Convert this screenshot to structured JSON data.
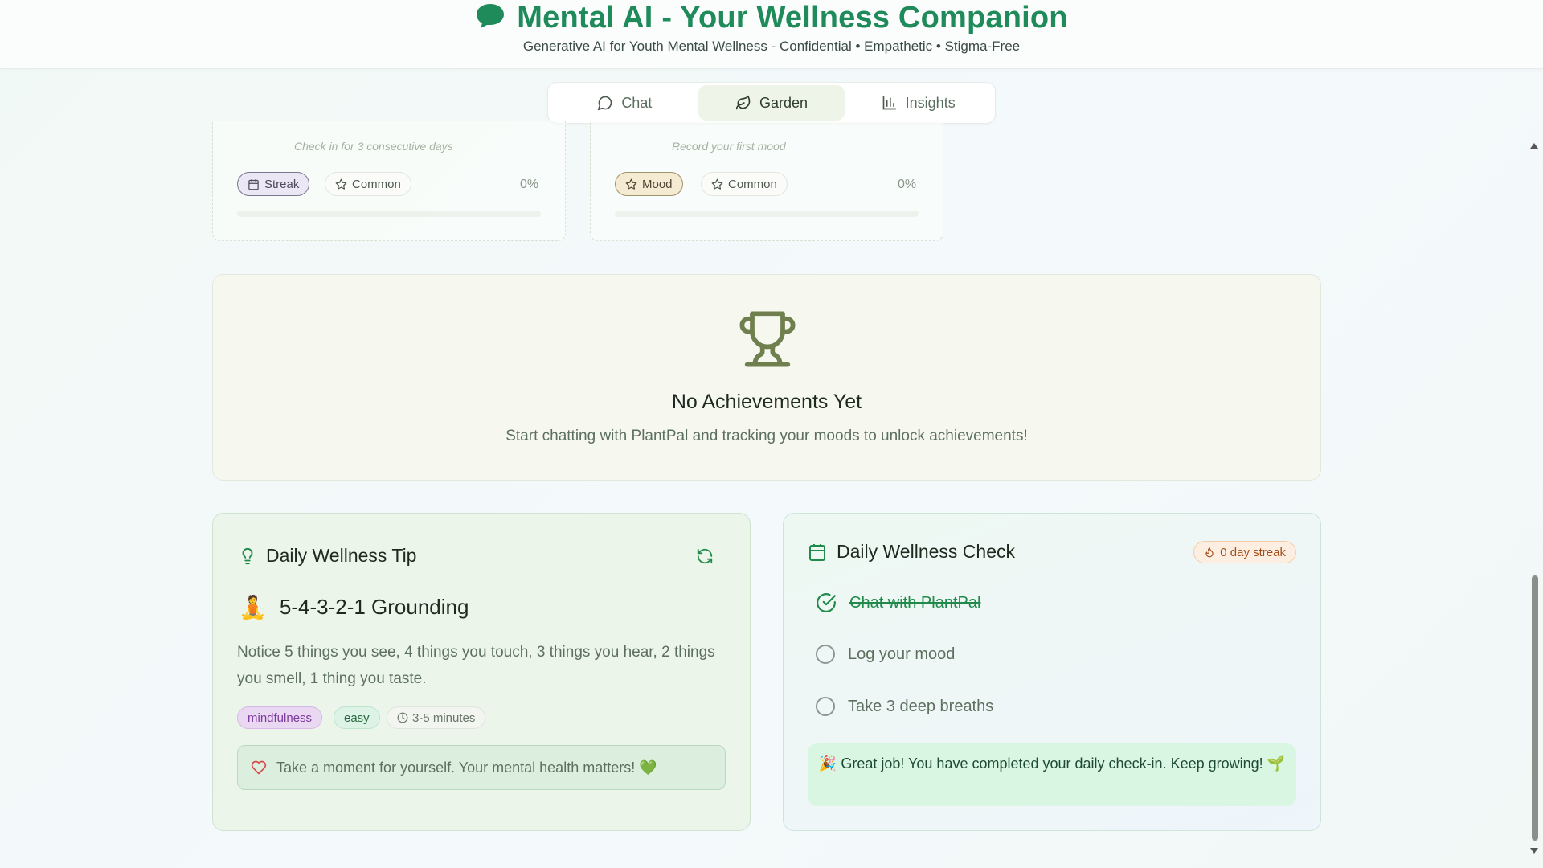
{
  "header": {
    "title": "Mental AI - Your Wellness Companion",
    "subtitle": "Generative AI for Youth Mental Wellness - Confidential • Empathetic • Stigma-Free"
  },
  "tabs": [
    {
      "label": "Chat",
      "icon": "chat-bubble-icon"
    },
    {
      "label": "Garden",
      "icon": "leaf-icon",
      "active": true
    },
    {
      "label": "Insights",
      "icon": "bar-chart-icon"
    }
  ],
  "achievements": [
    {
      "description": "Check in for 3 consecutive days",
      "category": "Streak",
      "rarity": "Common",
      "progress": "0%"
    },
    {
      "description": "Record your first mood",
      "category": "Mood",
      "rarity": "Common",
      "progress": "0%"
    }
  ],
  "no_achievements": {
    "title": "No Achievements Yet",
    "subtitle": "Start chatting with PlantPal and tracking your moods to unlock achievements!"
  },
  "tip": {
    "heading": "Daily Wellness Tip",
    "emoji": "🧘",
    "title": "5-4-3-2-1 Grounding",
    "text": "Notice 5 things you see, 4 things you touch, 3 things you hear, 2 things you smell, 1 thing you taste.",
    "tags": {
      "category": "mindfulness",
      "difficulty": "easy",
      "duration": "3-5 minutes"
    },
    "note": "Take a moment for yourself. Your mental health matters! 💚"
  },
  "check": {
    "heading": "Daily Wellness Check",
    "streak": "0 day streak",
    "items": [
      {
        "label": "Chat with PlantPal",
        "done": true
      },
      {
        "label": "Log your mood",
        "done": false
      },
      {
        "label": "Take 3 deep breaths",
        "done": false
      }
    ],
    "congrats": "🎉 Great job! You have completed your daily check-in. Keep growing! 🌱"
  }
}
